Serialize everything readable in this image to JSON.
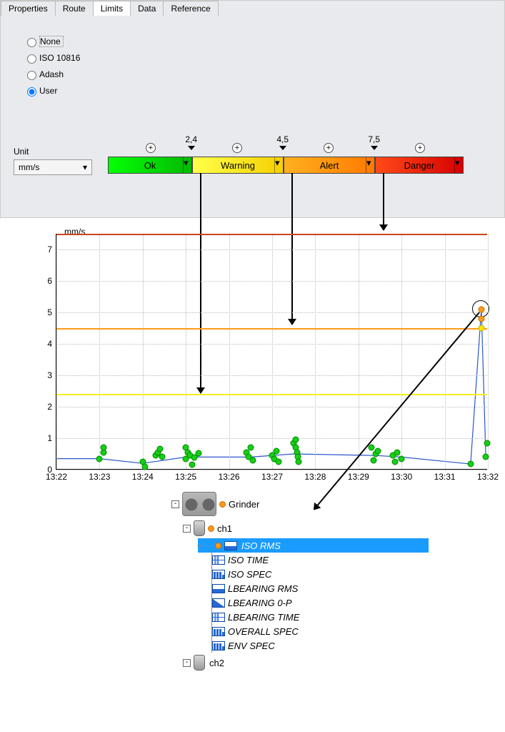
{
  "tabs": [
    "Properties",
    "Route",
    "Limits",
    "Data",
    "Reference"
  ],
  "active_tab": "Limits",
  "radios": {
    "none": "None",
    "iso": "ISO 10816",
    "adash": "Adash",
    "user": "User"
  },
  "selected_radio": "user",
  "unit_label": "Unit",
  "unit_value": "mm/s",
  "thresholds": {
    "ok": "Ok",
    "warning": "Warning",
    "alert": "Alert",
    "danger": "Danger",
    "v1": "2,4",
    "v2": "4,5",
    "v3": "7,5"
  },
  "chart_data": {
    "type": "scatter",
    "ylabel": "mm/s",
    "ylim": [
      0,
      7.5
    ],
    "yticks": [
      0,
      1,
      2,
      3,
      4,
      5,
      6,
      7
    ],
    "xticks": [
      "13:22",
      "13:23",
      "13:24",
      "13:25",
      "13:26",
      "13:27",
      "13:28",
      "13:29",
      "13:30",
      "13:31",
      "13:32"
    ],
    "limits": {
      "warning": 2.4,
      "alert": 4.5,
      "danger": 7.5
    },
    "series": [
      {
        "name": "ISO RMS",
        "points": [
          {
            "x": 0.1,
            "y": 0.35,
            "s": "ok"
          },
          {
            "x": 0.11,
            "y": 0.55,
            "s": "ok"
          },
          {
            "x": 0.11,
            "y": 0.7,
            "s": "ok"
          },
          {
            "x": 0.2,
            "y": 0.25,
            "s": "ok"
          },
          {
            "x": 0.205,
            "y": 0.1,
            "s": "ok"
          },
          {
            "x": 0.23,
            "y": 0.45,
            "s": "ok"
          },
          {
            "x": 0.235,
            "y": 0.55,
            "s": "ok"
          },
          {
            "x": 0.24,
            "y": 0.65,
            "s": "ok"
          },
          {
            "x": 0.245,
            "y": 0.4,
            "s": "ok"
          },
          {
            "x": 0.3,
            "y": 0.7,
            "s": "ok"
          },
          {
            "x": 0.305,
            "y": 0.55,
            "s": "ok"
          },
          {
            "x": 0.31,
            "y": 0.45,
            "s": "ok"
          },
          {
            "x": 0.3,
            "y": 0.35,
            "s": "ok"
          },
          {
            "x": 0.315,
            "y": 0.15,
            "s": "ok"
          },
          {
            "x": 0.32,
            "y": 0.38,
            "s": "ok"
          },
          {
            "x": 0.33,
            "y": 0.52,
            "s": "ok"
          },
          {
            "x": 0.44,
            "y": 0.55,
            "s": "ok"
          },
          {
            "x": 0.445,
            "y": 0.4,
            "s": "ok"
          },
          {
            "x": 0.45,
            "y": 0.7,
            "s": "ok"
          },
          {
            "x": 0.455,
            "y": 0.3,
            "s": "ok"
          },
          {
            "x": 0.5,
            "y": 0.45,
            "s": "ok"
          },
          {
            "x": 0.505,
            "y": 0.35,
            "s": "ok"
          },
          {
            "x": 0.51,
            "y": 0.6,
            "s": "ok"
          },
          {
            "x": 0.515,
            "y": 0.25,
            "s": "ok"
          },
          {
            "x": 0.55,
            "y": 0.85,
            "s": "ok"
          },
          {
            "x": 0.555,
            "y": 0.7,
            "s": "ok"
          },
          {
            "x": 0.555,
            "y": 0.95,
            "s": "ok"
          },
          {
            "x": 0.558,
            "y": 0.55,
            "s": "ok"
          },
          {
            "x": 0.56,
            "y": 0.4,
            "s": "ok"
          },
          {
            "x": 0.562,
            "y": 0.25,
            "s": "ok"
          },
          {
            "x": 0.73,
            "y": 0.7,
            "s": "ok"
          },
          {
            "x": 0.735,
            "y": 0.3,
            "s": "ok"
          },
          {
            "x": 0.74,
            "y": 0.5,
            "s": "ok"
          },
          {
            "x": 0.745,
            "y": 0.6,
            "s": "ok"
          },
          {
            "x": 0.78,
            "y": 0.45,
            "s": "ok"
          },
          {
            "x": 0.785,
            "y": 0.25,
            "s": "ok"
          },
          {
            "x": 0.79,
            "y": 0.55,
            "s": "ok"
          },
          {
            "x": 0.8,
            "y": 0.35,
            "s": "ok"
          },
          {
            "x": 0.96,
            "y": 0.18,
            "s": "ok"
          },
          {
            "x": 0.995,
            "y": 0.4,
            "s": "ok"
          },
          {
            "x": 0.998,
            "y": 0.85,
            "s": "ok"
          },
          {
            "x": 0.985,
            "y": 4.5,
            "s": "warn"
          },
          {
            "x": 0.985,
            "y": 4.8,
            "s": "alert"
          },
          {
            "x": 0.985,
            "y": 5.1,
            "s": "alert"
          }
        ]
      }
    ]
  },
  "tree": {
    "grinder": "Grinder",
    "ch1": "ch1",
    "ch2": "ch2",
    "items": [
      "ISO RMS",
      "ISO TIME",
      "ISO SPEC",
      "LBEARING RMS",
      "LBEARING 0-P",
      "LBEARING TIME",
      "OVERALL SPEC",
      "ENV SPEC"
    ],
    "selected": "ISO RMS"
  }
}
